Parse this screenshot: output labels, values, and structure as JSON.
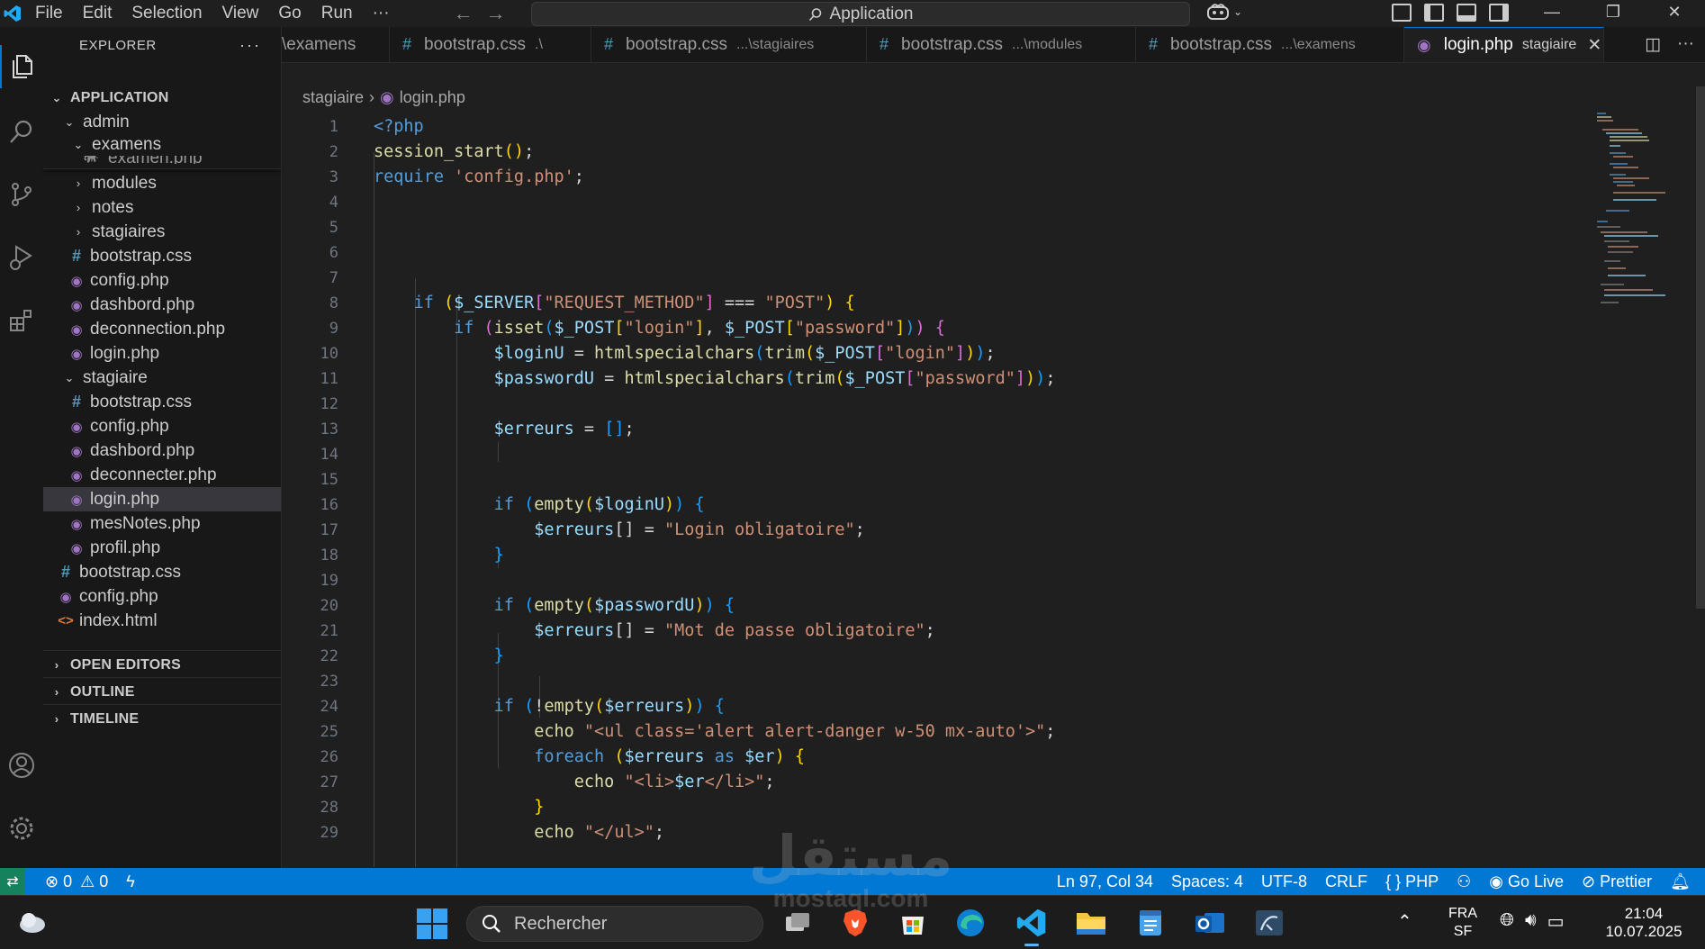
{
  "titlebar": {
    "menu": [
      "File",
      "Edit",
      "Selection",
      "View",
      "Go",
      "Run",
      "···"
    ],
    "search": "Application",
    "icons": [
      "vscode-logo",
      "arrow-left-icon",
      "arrow-right-icon",
      "copilot-icon",
      "layout-icons",
      "minimize-icon",
      "restore-icon",
      "close-icon"
    ]
  },
  "activitybar": [
    "explorer-icon",
    "search-icon",
    "source-control-icon",
    "run-debug-icon",
    "extensions-icon",
    "account-icon",
    "settings-icon"
  ],
  "sidebar": {
    "title": "EXPLORER",
    "more": "···",
    "root": "APPLICATION",
    "items": [
      {
        "label": "admin"
      },
      {
        "label": "examens"
      },
      {
        "label": "examen.php"
      },
      {
        "label": "modules"
      },
      {
        "label": "notes"
      },
      {
        "label": "stagiaires"
      },
      {
        "label": "bootstrap.css"
      },
      {
        "label": "config.php"
      },
      {
        "label": "dashbord.php"
      },
      {
        "label": "deconnection.php"
      },
      {
        "label": "login.php"
      },
      {
        "label": "stagiaire"
      },
      {
        "label": "bootstrap.css"
      },
      {
        "label": "config.php"
      },
      {
        "label": "dashbord.php"
      },
      {
        "label": "deconnecter.php"
      },
      {
        "label": "login.php"
      },
      {
        "label": "mesNotes.php"
      },
      {
        "label": "profil.php"
      },
      {
        "label": "bootstrap.css"
      },
      {
        "label": "config.php"
      },
      {
        "label": "index.html"
      }
    ],
    "sections": [
      "OPEN EDITORS",
      "OUTLINE",
      "TIMELINE"
    ]
  },
  "tabs": [
    {
      "name": "\\examens",
      "desc": ""
    },
    {
      "name": "bootstrap.css",
      "desc": ".\\"
    },
    {
      "name": "bootstrap.css",
      "desc": "...\\stagiaires"
    },
    {
      "name": "bootstrap.css",
      "desc": "...\\modules"
    },
    {
      "name": "bootstrap.css",
      "desc": "...\\examens"
    },
    {
      "name": "login.php",
      "desc": "stagiaire"
    }
  ],
  "breadcrumb": {
    "folder": "stagiaire",
    "file": "login.php"
  },
  "editor": {
    "line_numbers": [
      "1",
      "2",
      "3",
      "4",
      "5",
      "6",
      "7",
      "8",
      "9",
      "10",
      "11",
      "12",
      "13",
      "14",
      "15",
      "16",
      "17",
      "18",
      "19",
      "20",
      "21",
      "22",
      "23",
      "24",
      "25",
      "26",
      "27",
      "28",
      "29"
    ]
  },
  "statusbar": {
    "errors": "0",
    "warnings": "0",
    "position": "Ln 97, Col 34",
    "spaces": "Spaces: 4",
    "encoding": "UTF-8",
    "eol": "CRLF",
    "language": "PHP",
    "golive": "Go Live",
    "prettier": "Prettier"
  },
  "taskbar": {
    "search": "Rechercher",
    "lang1": "FRA",
    "lang2": "SF",
    "time": "21:04",
    "date": "10.07.2025"
  },
  "watermark": {
    "arabic": "مستقل",
    "latin": "mostaql.com"
  },
  "colors": {
    "accent": "#0078d4",
    "status_bar": "#0078d4",
    "keyword": "#569cd6",
    "string": "#ce9178",
    "variable": "#9cdcfe",
    "function": "#dcdcaa"
  }
}
